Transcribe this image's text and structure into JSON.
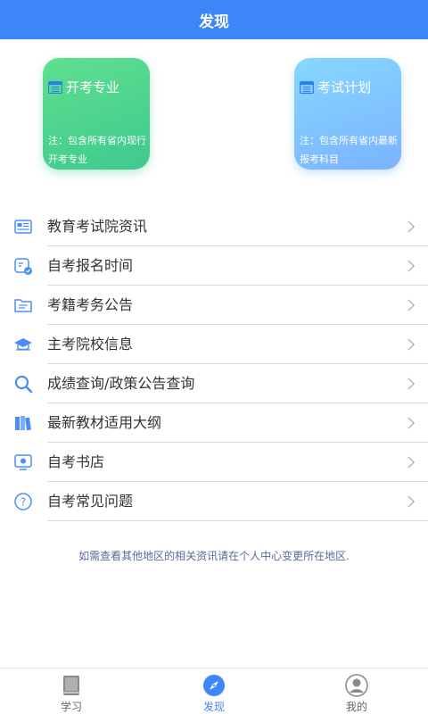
{
  "header": {
    "title": "发现"
  },
  "cards": [
    {
      "title": "开考专业",
      "note": "注：包含所有省内现行开考专业",
      "icon": "calendar-grid-icon"
    },
    {
      "title": "考试计划",
      "note": "注：包含所有省内最新报考科目",
      "icon": "calendar-grid-icon"
    }
  ],
  "menu": [
    {
      "label": "教育考试院资讯",
      "icon": "newspaper-icon"
    },
    {
      "label": "自考报名时间",
      "icon": "registration-clock-icon"
    },
    {
      "label": "考籍考务公告",
      "icon": "folder-document-icon"
    },
    {
      "label": "主考院校信息",
      "icon": "graduation-cap-icon"
    },
    {
      "label": "成绩查询/政策公告查询",
      "icon": "search-icon"
    },
    {
      "label": "最新教材适用大纲",
      "icon": "books-icon"
    },
    {
      "label": "自考书店",
      "icon": "store-screen-icon"
    },
    {
      "label": "自考常见问题",
      "icon": "question-icon"
    }
  ],
  "footnote": "如需查看其他地区的相关资讯请在个人中心变更所在地区.",
  "tabs": [
    {
      "label": "学习",
      "icon": "book-icon",
      "active": false
    },
    {
      "label": "发现",
      "icon": "compass-icon",
      "active": true
    },
    {
      "label": "我的",
      "icon": "user-icon",
      "active": false
    }
  ],
  "colors": {
    "primary": "#3d86f7",
    "card_green": "#4fd58f",
    "card_blue": "#80c4ff",
    "divider": "#d9d9d9"
  }
}
